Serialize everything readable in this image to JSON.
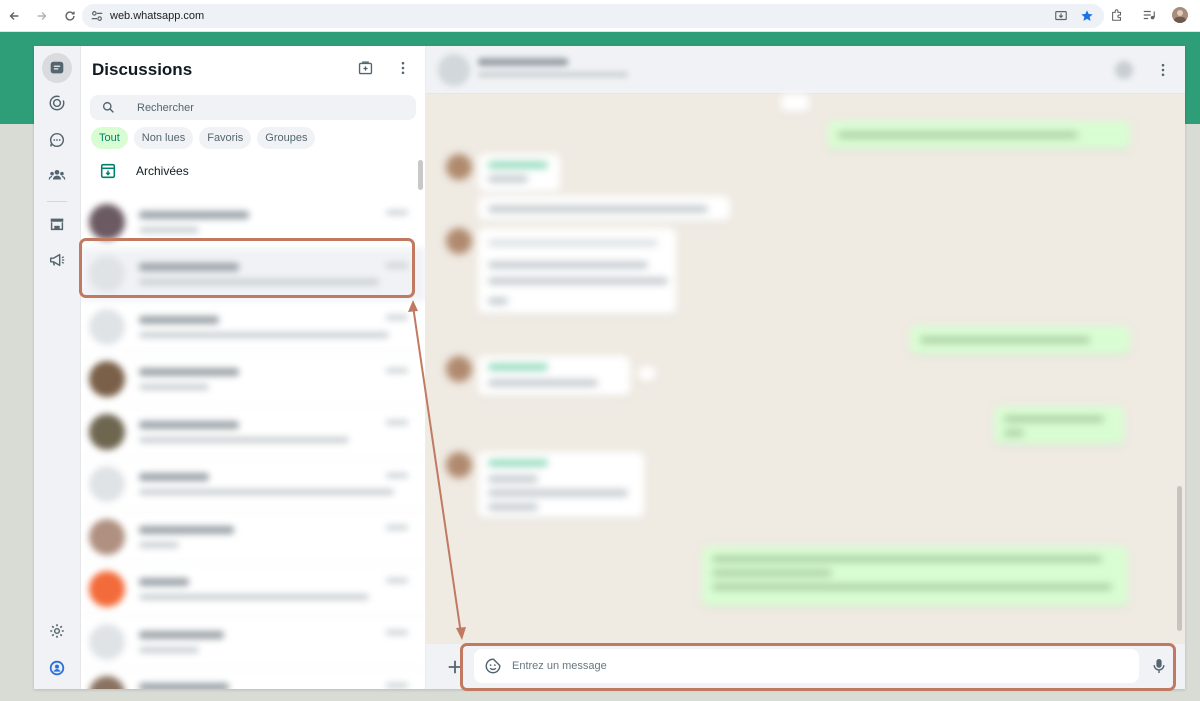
{
  "browser": {
    "url": "web.whatsapp.com"
  },
  "sidebar": {
    "title": "Discussions",
    "search_placeholder": "Rechercher",
    "filters": [
      {
        "label": "Tout",
        "active": true
      },
      {
        "label": "Non lues",
        "active": false
      },
      {
        "label": "Favoris",
        "active": false
      },
      {
        "label": "Groupes",
        "active": false
      }
    ],
    "archived_label": "Archivées"
  },
  "rail": {
    "icons": [
      "chats-icon",
      "status-icon",
      "channels-icon",
      "communities-icon",
      "store-icon",
      "megaphone-icon",
      "settings-icon",
      "profile-icon"
    ]
  },
  "composer": {
    "placeholder": "Entrez un message"
  },
  "colors": {
    "brand_green": "#2e9e78",
    "accent": "#008069",
    "highlight": "#c07a62",
    "chat_bg": "#efeae2",
    "outgoing_bubble": "#d9fdd3"
  }
}
